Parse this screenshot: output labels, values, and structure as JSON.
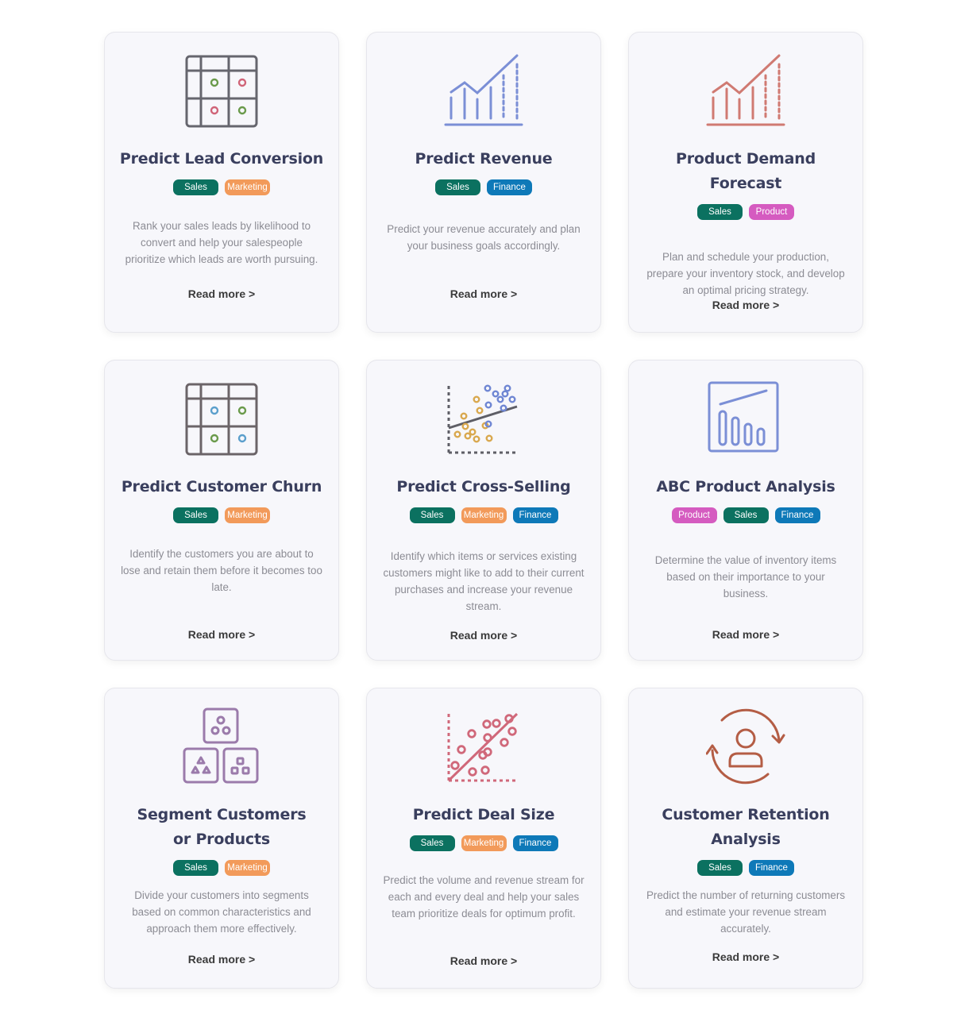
{
  "cards": [
    {
      "title": "Predict Lead Conversion",
      "icon": "lead-matrix-icon",
      "tags": [
        "Sales",
        "Marketing"
      ],
      "description": "Rank your sales leads by likelihood to convert and help your salespeople prioritize which leads are worth pursuing.",
      "link": "Read more >"
    },
    {
      "title": "Predict Revenue",
      "icon": "revenue-chart-icon",
      "tags": [
        "Sales",
        "Finance"
      ],
      "description": "Predict your revenue accurately and plan your business goals accordingly.",
      "link": "Read more >"
    },
    {
      "title": "Product Demand Forecast",
      "icon": "demand-chart-icon",
      "tags": [
        "Sales",
        "Product"
      ],
      "description": "Plan and schedule your production, prepare your inventory stock, and develop an optimal pricing strategy.",
      "link": "Read more >"
    },
    {
      "title": "Predict Customer Churn",
      "icon": "churn-matrix-icon",
      "tags": [
        "Sales",
        "Marketing"
      ],
      "description": "Identify the customers you are about to lose and retain them before it becomes too late.",
      "link": "Read more >"
    },
    {
      "title": "Predict Cross-Selling",
      "icon": "scatter-regression-icon",
      "tags": [
        "Sales",
        "Marketing",
        "Finance"
      ],
      "description": "Identify which items or services existing customers might like to add to their current purchases and increase your revenue stream.",
      "link": "Read more >"
    },
    {
      "title": "ABC Product Analysis",
      "icon": "abc-bars-icon",
      "tags": [
        "Product",
        "Sales",
        "Finance"
      ],
      "description": "Determine the value of inventory items based on their importance to your business.",
      "link": "Read more >"
    },
    {
      "title": "Segment Customers or Products",
      "icon": "segment-blocks-icon",
      "tags": [
        "Sales",
        "Marketing"
      ],
      "description": "Divide your customers into segments based on common characteristics and approach them more effectively.",
      "link": "Read more >"
    },
    {
      "title": "Predict Deal Size",
      "icon": "deal-scatter-icon",
      "tags": [
        "Sales",
        "Marketing",
        "Finance"
      ],
      "description": "Predict the volume and revenue stream for each and every deal and help your sales team prioritize deals for optimum profit.",
      "link": "Read more >"
    },
    {
      "title": "Customer Retention Analysis",
      "icon": "customer-retention-icon",
      "tags": [
        "Sales",
        "Finance"
      ],
      "description": "Predict the number of returning customers and estimate your revenue stream accurately.",
      "link": "Read more >"
    }
  ],
  "tag_colors": {
    "Sales": "#0b7160",
    "Marketing": "#f29a5a",
    "Finance": "#0e79b8",
    "Product": "#d55bc0"
  },
  "icon_colors": {
    "grid_stroke": "#66666e",
    "revenue": "#7b8fd6",
    "demand": "#d07a72",
    "scatter_orange": "#d9a84e",
    "scatter_blue": "#6f86d3",
    "abc": "#7b8fd6",
    "segment": "#9b7bab",
    "deal": "#d0687a",
    "retention": "#b45d45",
    "lead_green": "#6a9a4b",
    "lead_red": "#d06478",
    "churn_blue": "#5b9fcc"
  }
}
